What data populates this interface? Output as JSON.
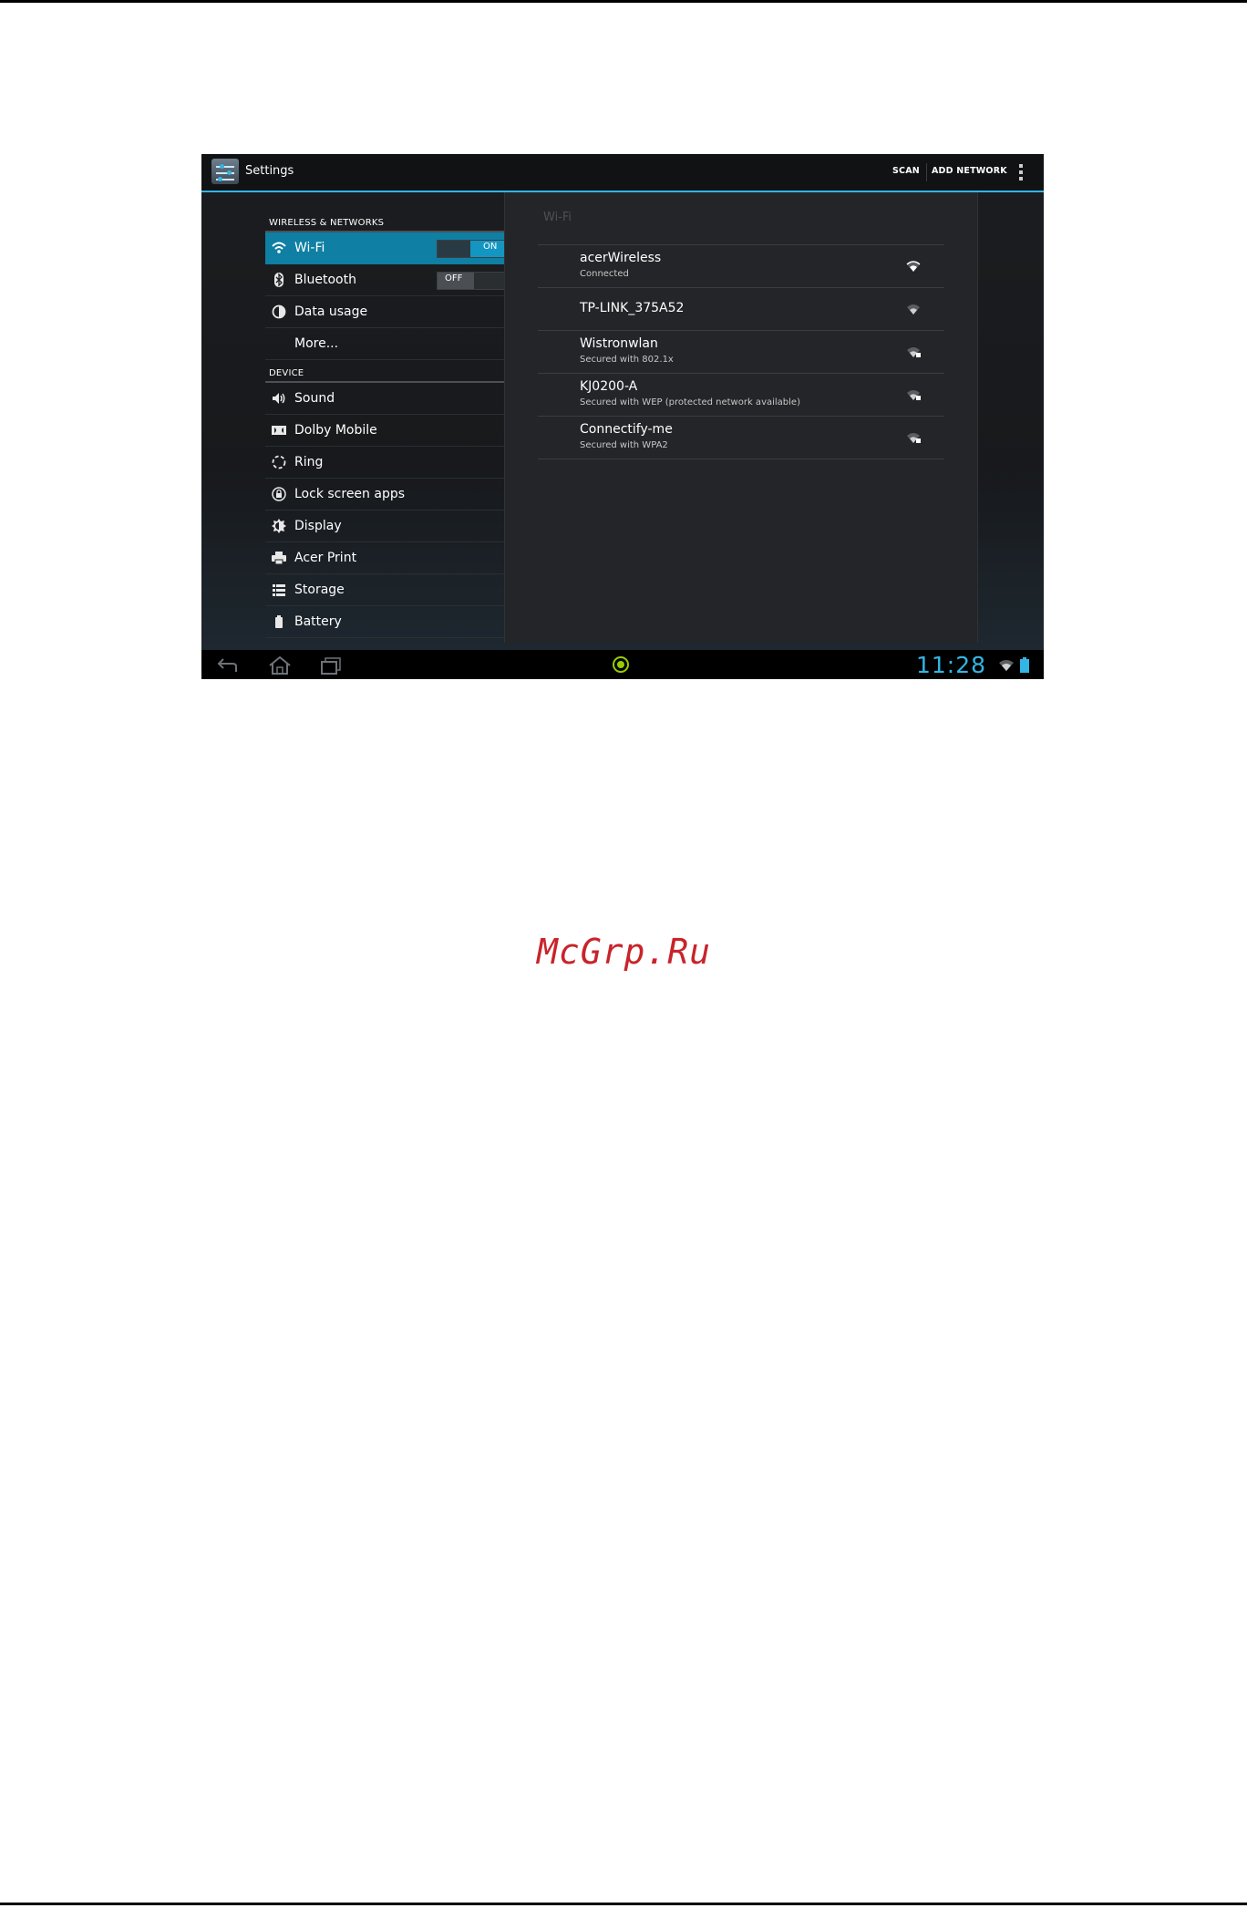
{
  "actionbar": {
    "title": "Settings",
    "actions": [
      "SCAN",
      "ADD NETWORK"
    ]
  },
  "sidebar": {
    "sections": [
      {
        "header": "WIRELESS & NETWORKS"
      },
      {
        "header": "DEVICE"
      }
    ],
    "items": [
      {
        "label": "Wi-Fi",
        "icon": "wifi-icon",
        "toggle": "ON"
      },
      {
        "label": "Bluetooth",
        "icon": "bluetooth-icon",
        "toggle": "OFF"
      },
      {
        "label": "Data usage",
        "icon": "data-usage-icon"
      },
      {
        "label": "More...",
        "icon": ""
      },
      {
        "label": "Sound",
        "icon": "speaker-icon"
      },
      {
        "label": "Dolby Mobile",
        "icon": "dolby-icon"
      },
      {
        "label": "Ring",
        "icon": "ring-icon"
      },
      {
        "label": "Lock screen apps",
        "icon": "lock-icon"
      },
      {
        "label": "Display",
        "icon": "brightness-icon"
      },
      {
        "label": "Acer Print",
        "icon": "printer-icon"
      },
      {
        "label": "Storage",
        "icon": "storage-icon"
      },
      {
        "label": "Battery",
        "icon": "battery-icon"
      }
    ]
  },
  "wifi_pane": {
    "title": "Wi-Fi",
    "networks": [
      {
        "name": "acerWireless",
        "status": "Connected",
        "secured": false
      },
      {
        "name": "TP-LINK_375A52",
        "status": "",
        "secured": false
      },
      {
        "name": "Wistronwlan",
        "status": "Secured with 802.1x",
        "secured": true
      },
      {
        "name": "KJ0200-A",
        "status": "Secured with WEP (protected network available)",
        "secured": true
      },
      {
        "name": "Connectify-me",
        "status": "Secured with WPA2",
        "secured": true
      }
    ]
  },
  "systembar": {
    "clock": "11:28",
    "nav": [
      "back-icon",
      "home-icon",
      "recent-apps-icon"
    ],
    "notification": "notification-ring-icon"
  },
  "watermark": "McGrp.Ru",
  "colors": {
    "accent": "#33b5e5",
    "selected": "#0f7fa3",
    "watermark": "#c8242a"
  }
}
